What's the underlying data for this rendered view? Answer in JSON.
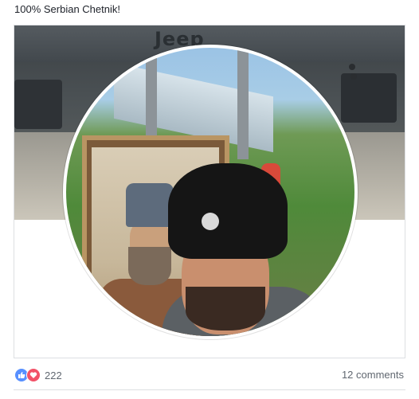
{
  "post": {
    "text": "100% Serbian Chetnik!"
  },
  "cover": {
    "brand_text": "Jeep"
  },
  "reactions": {
    "icons": [
      "like-icon",
      "love-icon"
    ],
    "count": "222"
  },
  "comments": {
    "label": "12 comments"
  },
  "colors": {
    "like": "#5890ff",
    "love": "#f25268",
    "meta_text": "#606770",
    "border": "#dddfe2"
  }
}
